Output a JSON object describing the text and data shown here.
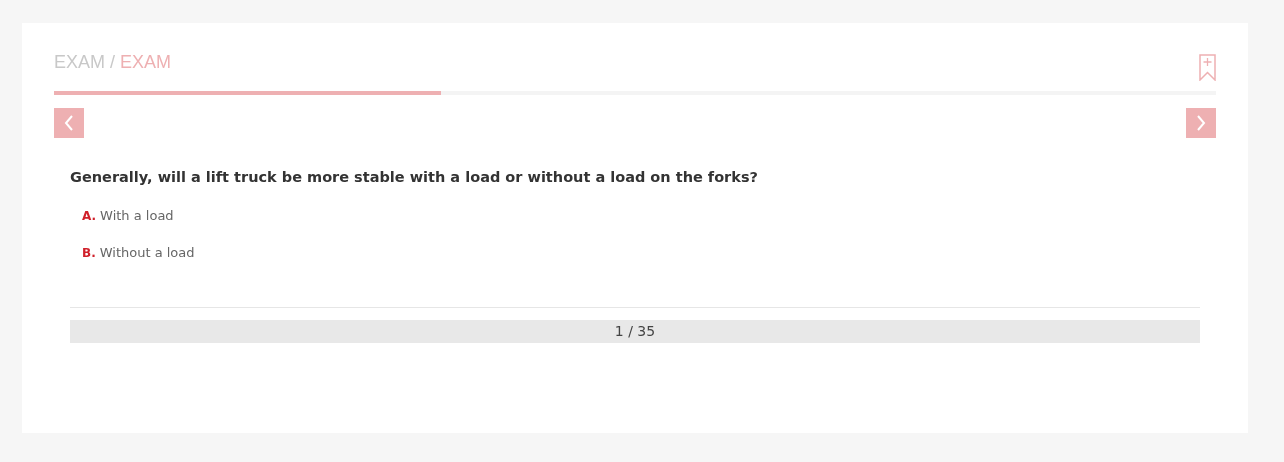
{
  "breadcrumb": [
    {
      "label": "EXAM",
      "current": false
    },
    {
      "label": "EXAM",
      "current": true
    }
  ],
  "breadcrumb_separator": "/",
  "progress": {
    "level": 0.333
  },
  "question": "Generally, will a lift truck be more stable with a load or without a load on the forks?",
  "options": [
    {
      "letter": "A.",
      "text": "With a load"
    },
    {
      "letter": "B.",
      "text": "Without a load"
    }
  ],
  "pager": "1 / 35"
}
